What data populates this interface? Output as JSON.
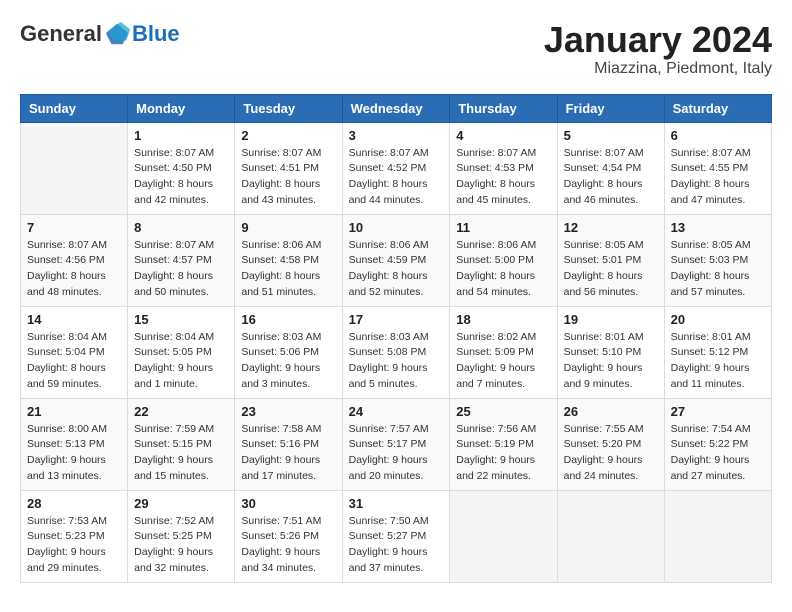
{
  "header": {
    "logo_general": "General",
    "logo_blue": "Blue",
    "month_title": "January 2024",
    "location": "Miazzina, Piedmont, Italy"
  },
  "weekdays": [
    "Sunday",
    "Monday",
    "Tuesday",
    "Wednesday",
    "Thursday",
    "Friday",
    "Saturday"
  ],
  "weeks": [
    [
      {
        "day": "",
        "info": ""
      },
      {
        "day": "1",
        "info": "Sunrise: 8:07 AM\nSunset: 4:50 PM\nDaylight: 8 hours\nand 42 minutes."
      },
      {
        "day": "2",
        "info": "Sunrise: 8:07 AM\nSunset: 4:51 PM\nDaylight: 8 hours\nand 43 minutes."
      },
      {
        "day": "3",
        "info": "Sunrise: 8:07 AM\nSunset: 4:52 PM\nDaylight: 8 hours\nand 44 minutes."
      },
      {
        "day": "4",
        "info": "Sunrise: 8:07 AM\nSunset: 4:53 PM\nDaylight: 8 hours\nand 45 minutes."
      },
      {
        "day": "5",
        "info": "Sunrise: 8:07 AM\nSunset: 4:54 PM\nDaylight: 8 hours\nand 46 minutes."
      },
      {
        "day": "6",
        "info": "Sunrise: 8:07 AM\nSunset: 4:55 PM\nDaylight: 8 hours\nand 47 minutes."
      }
    ],
    [
      {
        "day": "7",
        "info": "Sunrise: 8:07 AM\nSunset: 4:56 PM\nDaylight: 8 hours\nand 48 minutes."
      },
      {
        "day": "8",
        "info": "Sunrise: 8:07 AM\nSunset: 4:57 PM\nDaylight: 8 hours\nand 50 minutes."
      },
      {
        "day": "9",
        "info": "Sunrise: 8:06 AM\nSunset: 4:58 PM\nDaylight: 8 hours\nand 51 minutes."
      },
      {
        "day": "10",
        "info": "Sunrise: 8:06 AM\nSunset: 4:59 PM\nDaylight: 8 hours\nand 52 minutes."
      },
      {
        "day": "11",
        "info": "Sunrise: 8:06 AM\nSunset: 5:00 PM\nDaylight: 8 hours\nand 54 minutes."
      },
      {
        "day": "12",
        "info": "Sunrise: 8:05 AM\nSunset: 5:01 PM\nDaylight: 8 hours\nand 56 minutes."
      },
      {
        "day": "13",
        "info": "Sunrise: 8:05 AM\nSunset: 5:03 PM\nDaylight: 8 hours\nand 57 minutes."
      }
    ],
    [
      {
        "day": "14",
        "info": "Sunrise: 8:04 AM\nSunset: 5:04 PM\nDaylight: 8 hours\nand 59 minutes."
      },
      {
        "day": "15",
        "info": "Sunrise: 8:04 AM\nSunset: 5:05 PM\nDaylight: 9 hours\nand 1 minute."
      },
      {
        "day": "16",
        "info": "Sunrise: 8:03 AM\nSunset: 5:06 PM\nDaylight: 9 hours\nand 3 minutes."
      },
      {
        "day": "17",
        "info": "Sunrise: 8:03 AM\nSunset: 5:08 PM\nDaylight: 9 hours\nand 5 minutes."
      },
      {
        "day": "18",
        "info": "Sunrise: 8:02 AM\nSunset: 5:09 PM\nDaylight: 9 hours\nand 7 minutes."
      },
      {
        "day": "19",
        "info": "Sunrise: 8:01 AM\nSunset: 5:10 PM\nDaylight: 9 hours\nand 9 minutes."
      },
      {
        "day": "20",
        "info": "Sunrise: 8:01 AM\nSunset: 5:12 PM\nDaylight: 9 hours\nand 11 minutes."
      }
    ],
    [
      {
        "day": "21",
        "info": "Sunrise: 8:00 AM\nSunset: 5:13 PM\nDaylight: 9 hours\nand 13 minutes."
      },
      {
        "day": "22",
        "info": "Sunrise: 7:59 AM\nSunset: 5:15 PM\nDaylight: 9 hours\nand 15 minutes."
      },
      {
        "day": "23",
        "info": "Sunrise: 7:58 AM\nSunset: 5:16 PM\nDaylight: 9 hours\nand 17 minutes."
      },
      {
        "day": "24",
        "info": "Sunrise: 7:57 AM\nSunset: 5:17 PM\nDaylight: 9 hours\nand 20 minutes."
      },
      {
        "day": "25",
        "info": "Sunrise: 7:56 AM\nSunset: 5:19 PM\nDaylight: 9 hours\nand 22 minutes."
      },
      {
        "day": "26",
        "info": "Sunrise: 7:55 AM\nSunset: 5:20 PM\nDaylight: 9 hours\nand 24 minutes."
      },
      {
        "day": "27",
        "info": "Sunrise: 7:54 AM\nSunset: 5:22 PM\nDaylight: 9 hours\nand 27 minutes."
      }
    ],
    [
      {
        "day": "28",
        "info": "Sunrise: 7:53 AM\nSunset: 5:23 PM\nDaylight: 9 hours\nand 29 minutes."
      },
      {
        "day": "29",
        "info": "Sunrise: 7:52 AM\nSunset: 5:25 PM\nDaylight: 9 hours\nand 32 minutes."
      },
      {
        "day": "30",
        "info": "Sunrise: 7:51 AM\nSunset: 5:26 PM\nDaylight: 9 hours\nand 34 minutes."
      },
      {
        "day": "31",
        "info": "Sunrise: 7:50 AM\nSunset: 5:27 PM\nDaylight: 9 hours\nand 37 minutes."
      },
      {
        "day": "",
        "info": ""
      },
      {
        "day": "",
        "info": ""
      },
      {
        "day": "",
        "info": ""
      }
    ]
  ]
}
